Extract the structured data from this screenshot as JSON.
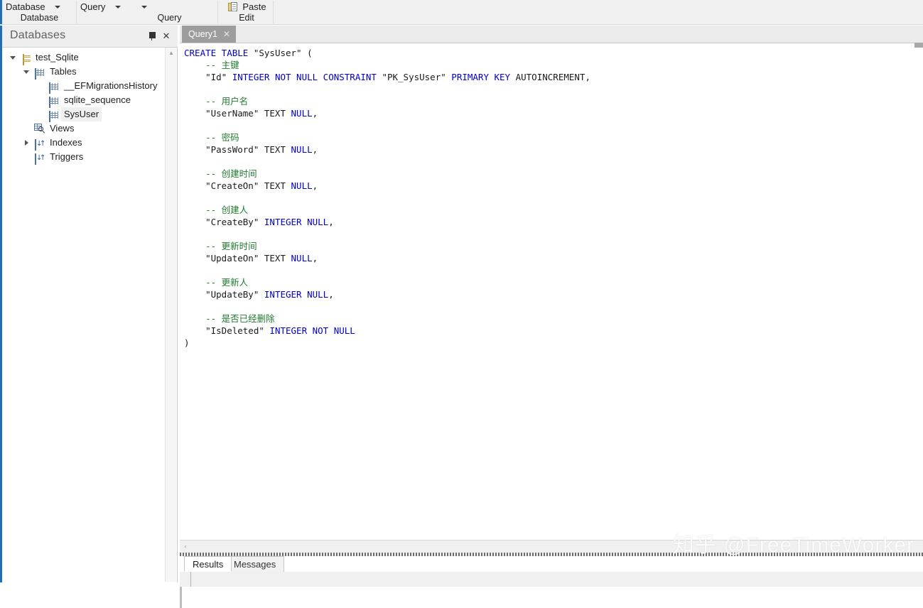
{
  "ribbon": {
    "groups": [
      {
        "top_label": "Database",
        "bottom_label": "Database",
        "has_caret": true
      },
      {
        "top_label": "Query",
        "bottom_label": "Query",
        "has_caret": true
      },
      {
        "top_label": "Paste",
        "bottom_label": "Edit",
        "has_caret": false
      }
    ]
  },
  "panel": {
    "title": "Databases",
    "pin_icon": "pin-icon",
    "close_icon": "close-icon"
  },
  "tree": {
    "nodes": [
      {
        "label": "test_Sqlite",
        "icon": "database-icon",
        "depth": 0,
        "state": "expanded",
        "selected": false
      },
      {
        "label": "Tables",
        "icon": "table-grid-icon",
        "depth": 1,
        "state": "expanded",
        "selected": false
      },
      {
        "label": "__EFMigrationsHistory",
        "icon": "table-grid-icon",
        "depth": 2,
        "state": "leaf",
        "selected": false
      },
      {
        "label": "sqlite_sequence",
        "icon": "table-grid-icon",
        "depth": 2,
        "state": "leaf",
        "selected": false
      },
      {
        "label": "SysUser",
        "icon": "table-grid-icon",
        "depth": 2,
        "state": "leaf",
        "selected": true
      },
      {
        "label": "Views",
        "icon": "views-icon",
        "depth": 1,
        "state": "leaf",
        "selected": false
      },
      {
        "label": "Indexes",
        "icon": "index-icon",
        "depth": 1,
        "state": "collapsed",
        "selected": false
      },
      {
        "label": "Triggers",
        "icon": "trigger-icon",
        "depth": 1,
        "state": "leaf",
        "selected": false
      }
    ]
  },
  "editor": {
    "tab_label": "Query1",
    "tab_close": "✕",
    "code_lines": [
      [
        {
          "t": "CREATE TABLE ",
          "c": "kw"
        },
        {
          "t": "\"SysUser\" (",
          "c": "pln"
        }
      ],
      [
        {
          "t": "    -- 主键",
          "c": "cmt"
        }
      ],
      [
        {
          "t": "    \"Id\" ",
          "c": "pln"
        },
        {
          "t": "INTEGER NOT NULL CONSTRAINT ",
          "c": "kw"
        },
        {
          "t": "\"PK_SysUser\" ",
          "c": "pln"
        },
        {
          "t": "PRIMARY KEY ",
          "c": "kw"
        },
        {
          "t": "AUTOINCREMENT,",
          "c": "pln"
        }
      ],
      [
        {
          "t": "",
          "c": "pln"
        }
      ],
      [
        {
          "t": "    -- 用户名",
          "c": "cmt"
        }
      ],
      [
        {
          "t": "    \"UserName\" TEXT ",
          "c": "pln"
        },
        {
          "t": "NULL",
          "c": "kw"
        },
        {
          "t": ",",
          "c": "pln"
        }
      ],
      [
        {
          "t": "",
          "c": "pln"
        }
      ],
      [
        {
          "t": "    -- 密码",
          "c": "cmt"
        }
      ],
      [
        {
          "t": "    \"PassWord\" TEXT ",
          "c": "pln"
        },
        {
          "t": "NULL",
          "c": "kw"
        },
        {
          "t": ",",
          "c": "pln"
        }
      ],
      [
        {
          "t": "",
          "c": "pln"
        }
      ],
      [
        {
          "t": "    -- 创建时间",
          "c": "cmt"
        }
      ],
      [
        {
          "t": "    \"CreateOn\" TEXT ",
          "c": "pln"
        },
        {
          "t": "NULL",
          "c": "kw"
        },
        {
          "t": ",",
          "c": "pln"
        }
      ],
      [
        {
          "t": "",
          "c": "pln"
        }
      ],
      [
        {
          "t": "    -- 创建人",
          "c": "cmt"
        }
      ],
      [
        {
          "t": "    \"CreateBy\" ",
          "c": "pln"
        },
        {
          "t": "INTEGER NULL",
          "c": "kw"
        },
        {
          "t": ",",
          "c": "pln"
        }
      ],
      [
        {
          "t": "",
          "c": "pln"
        }
      ],
      [
        {
          "t": "    -- 更新时间",
          "c": "cmt"
        }
      ],
      [
        {
          "t": "    \"UpdateOn\" TEXT ",
          "c": "pln"
        },
        {
          "t": "NULL",
          "c": "kw"
        },
        {
          "t": ",",
          "c": "pln"
        }
      ],
      [
        {
          "t": "",
          "c": "pln"
        }
      ],
      [
        {
          "t": "    -- 更新人",
          "c": "cmt"
        }
      ],
      [
        {
          "t": "    \"UpdateBy\" ",
          "c": "pln"
        },
        {
          "t": "INTEGER NULL",
          "c": "kw"
        },
        {
          "t": ",",
          "c": "pln"
        }
      ],
      [
        {
          "t": "",
          "c": "pln"
        }
      ],
      [
        {
          "t": "    -- 是否已经删除",
          "c": "cmt"
        }
      ],
      [
        {
          "t": "    \"IsDeleted\" ",
          "c": "pln"
        },
        {
          "t": "INTEGER NOT NULL",
          "c": "kw"
        }
      ],
      [
        {
          "t": ")",
          "c": "pln"
        }
      ]
    ],
    "hscroll_left_arrow": "‹"
  },
  "results": {
    "tabs": [
      {
        "label": "Results",
        "active": true
      },
      {
        "label": "Messages",
        "active": false
      }
    ]
  },
  "watermark": {
    "text": "知乎 @FreeTimeWorker"
  },
  "colors": {
    "accent": "#1e6fb8",
    "keyword": "#0000cd",
    "comment": "#1f7a2e",
    "tab_active_bg": "#9d9d9d",
    "panel_header_bg": "#eeeeee"
  }
}
